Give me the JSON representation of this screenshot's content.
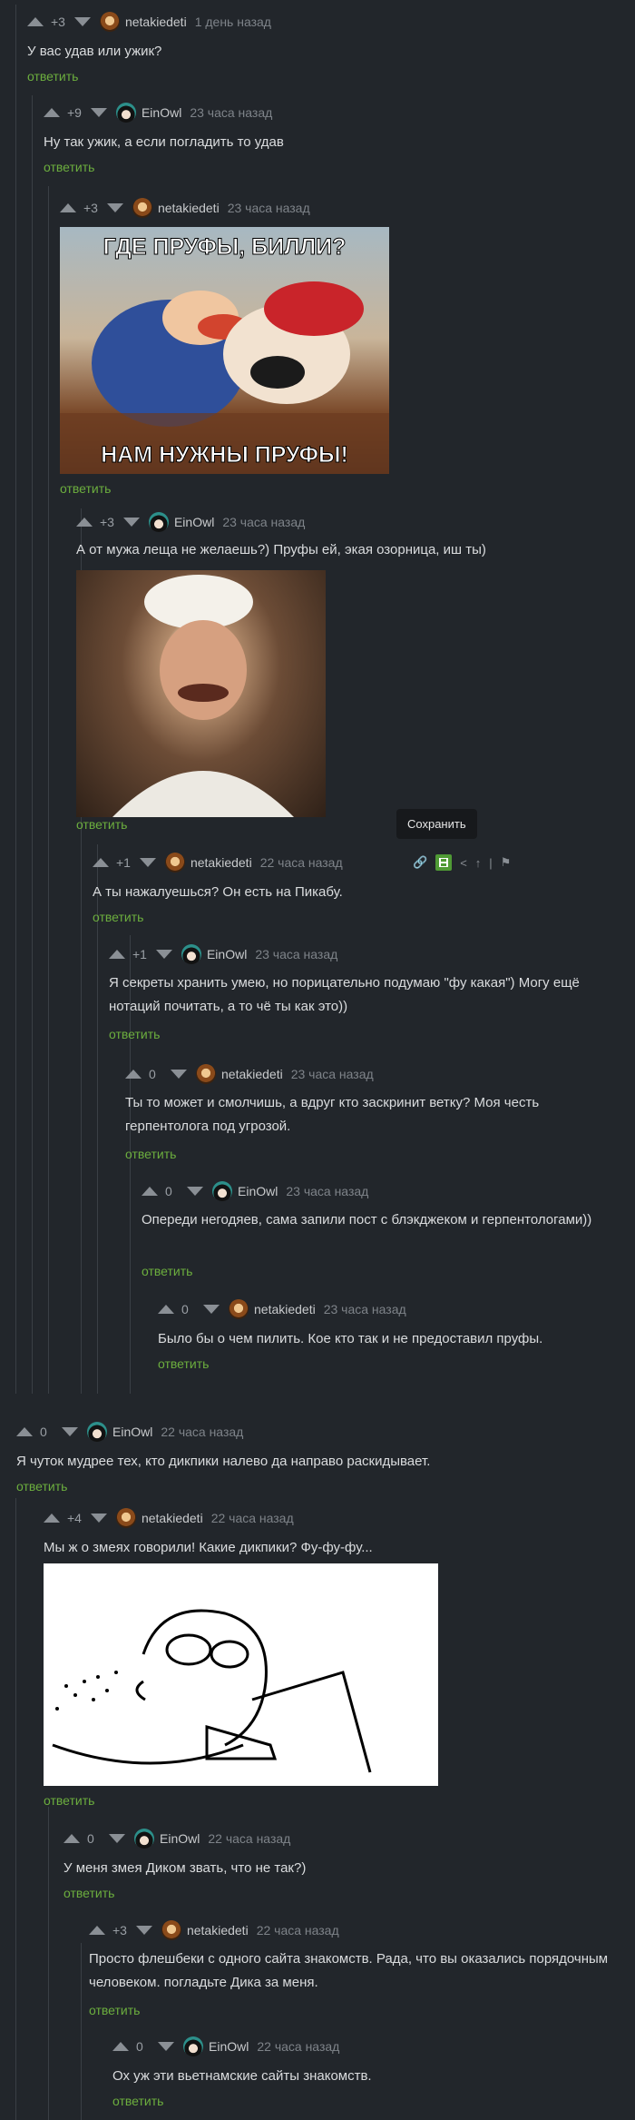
{
  "comments": [
    {
      "rating": "+3",
      "user": "netakiedeti",
      "time": "1 день назад",
      "text": "У вас удав или ужик?",
      "reply": "ответить"
    },
    {
      "rating": "+9",
      "user": "EinOwl",
      "time": "23 часа назад",
      "text": "Ну так ужик, а если погладить то удав",
      "reply": "ответить"
    },
    {
      "rating": "+3",
      "user": "netakiedeti",
      "time": "23 часа назад",
      "text": "",
      "reply": "ответить",
      "image": {
        "top": "ГДЕ ПРУФЫ, БИЛЛИ?",
        "bottom": "НАМ НУЖНЫ ПРУФЫ!"
      }
    },
    {
      "rating": "+3",
      "user": "EinOwl",
      "time": "23 часа назад",
      "text": "А от мужа леща не желаешь?) Пруфы ей, экая озорница, иш ты)",
      "reply": "ответить"
    },
    {
      "rating": "+1",
      "user": "netakiedeti",
      "time": "22 часа назад",
      "text": "А ты нажалуешься? Он есть на Пикабу.",
      "reply": "ответить"
    },
    {
      "rating": "+1",
      "user": "EinOwl",
      "time": "23 часа назад",
      "text": "Я секреты хранить умею, но порицательно подумаю \"фу какая\") Могу ещё нотаций почитать, а то чё ты как это))",
      "reply": "ответить"
    },
    {
      "rating": "0",
      "user": "netakiedeti",
      "time": "23 часа назад",
      "text": "Ты то может и смолчишь, а вдруг кто заскринит ветку? Моя честь герпентолога под угрозой.",
      "reply": "ответить"
    },
    {
      "rating": "0",
      "user": "EinOwl",
      "time": "23 часа назад",
      "text": "Опереди негодяев, сама запили пост с блэкджеком и герпентологами))",
      "reply": "ответить"
    },
    {
      "rating": "0",
      "user": "netakiedeti",
      "time": "23 часа назад",
      "text": "Было бы о чем пилить. Кое кто так и не предоставил пруфы.",
      "reply": "ответить"
    },
    {
      "rating": "0",
      "user": "EinOwl",
      "time": "22 часа назад",
      "text": "Я чуток мудрее тех, кто дикпики налево да направо раскидывает.",
      "reply": "ответить"
    },
    {
      "rating": "+4",
      "user": "netakiedeti",
      "time": "22 часа назад",
      "text": "Мы ж о змеях говорили! Какие дикпики? Фу-фу-фу...",
      "reply": "ответить"
    },
    {
      "rating": "0",
      "user": "EinOwl",
      "time": "22 часа назад",
      "text": "У меня змея Диком звать, что не так?)",
      "reply": "ответить"
    },
    {
      "rating": "+3",
      "user": "netakiedeti",
      "time": "22 часа назад",
      "text": "Просто флешбеки с одного сайта знакомств. Рада, что вы оказались порядочным человеком. погладьте Дика за меня.",
      "reply": "ответить"
    },
    {
      "rating": "0",
      "user": "EinOwl",
      "time": "22 часа назад",
      "text": "Ох уж эти вьетнамские сайты знакомств.",
      "reply": "ответить"
    }
  ],
  "tooltip": "Сохранить",
  "icons": [
    "arrow-up-icon",
    "arrow-down-icon",
    "link-icon",
    "save-icon",
    "share-icon",
    "pin-icon",
    "thread-icon",
    "flag-icon"
  ],
  "colors": {
    "background": "#22262b",
    "reply_link": "#6cae3e",
    "text": "#dadcde",
    "muted": "#7e8389"
  }
}
